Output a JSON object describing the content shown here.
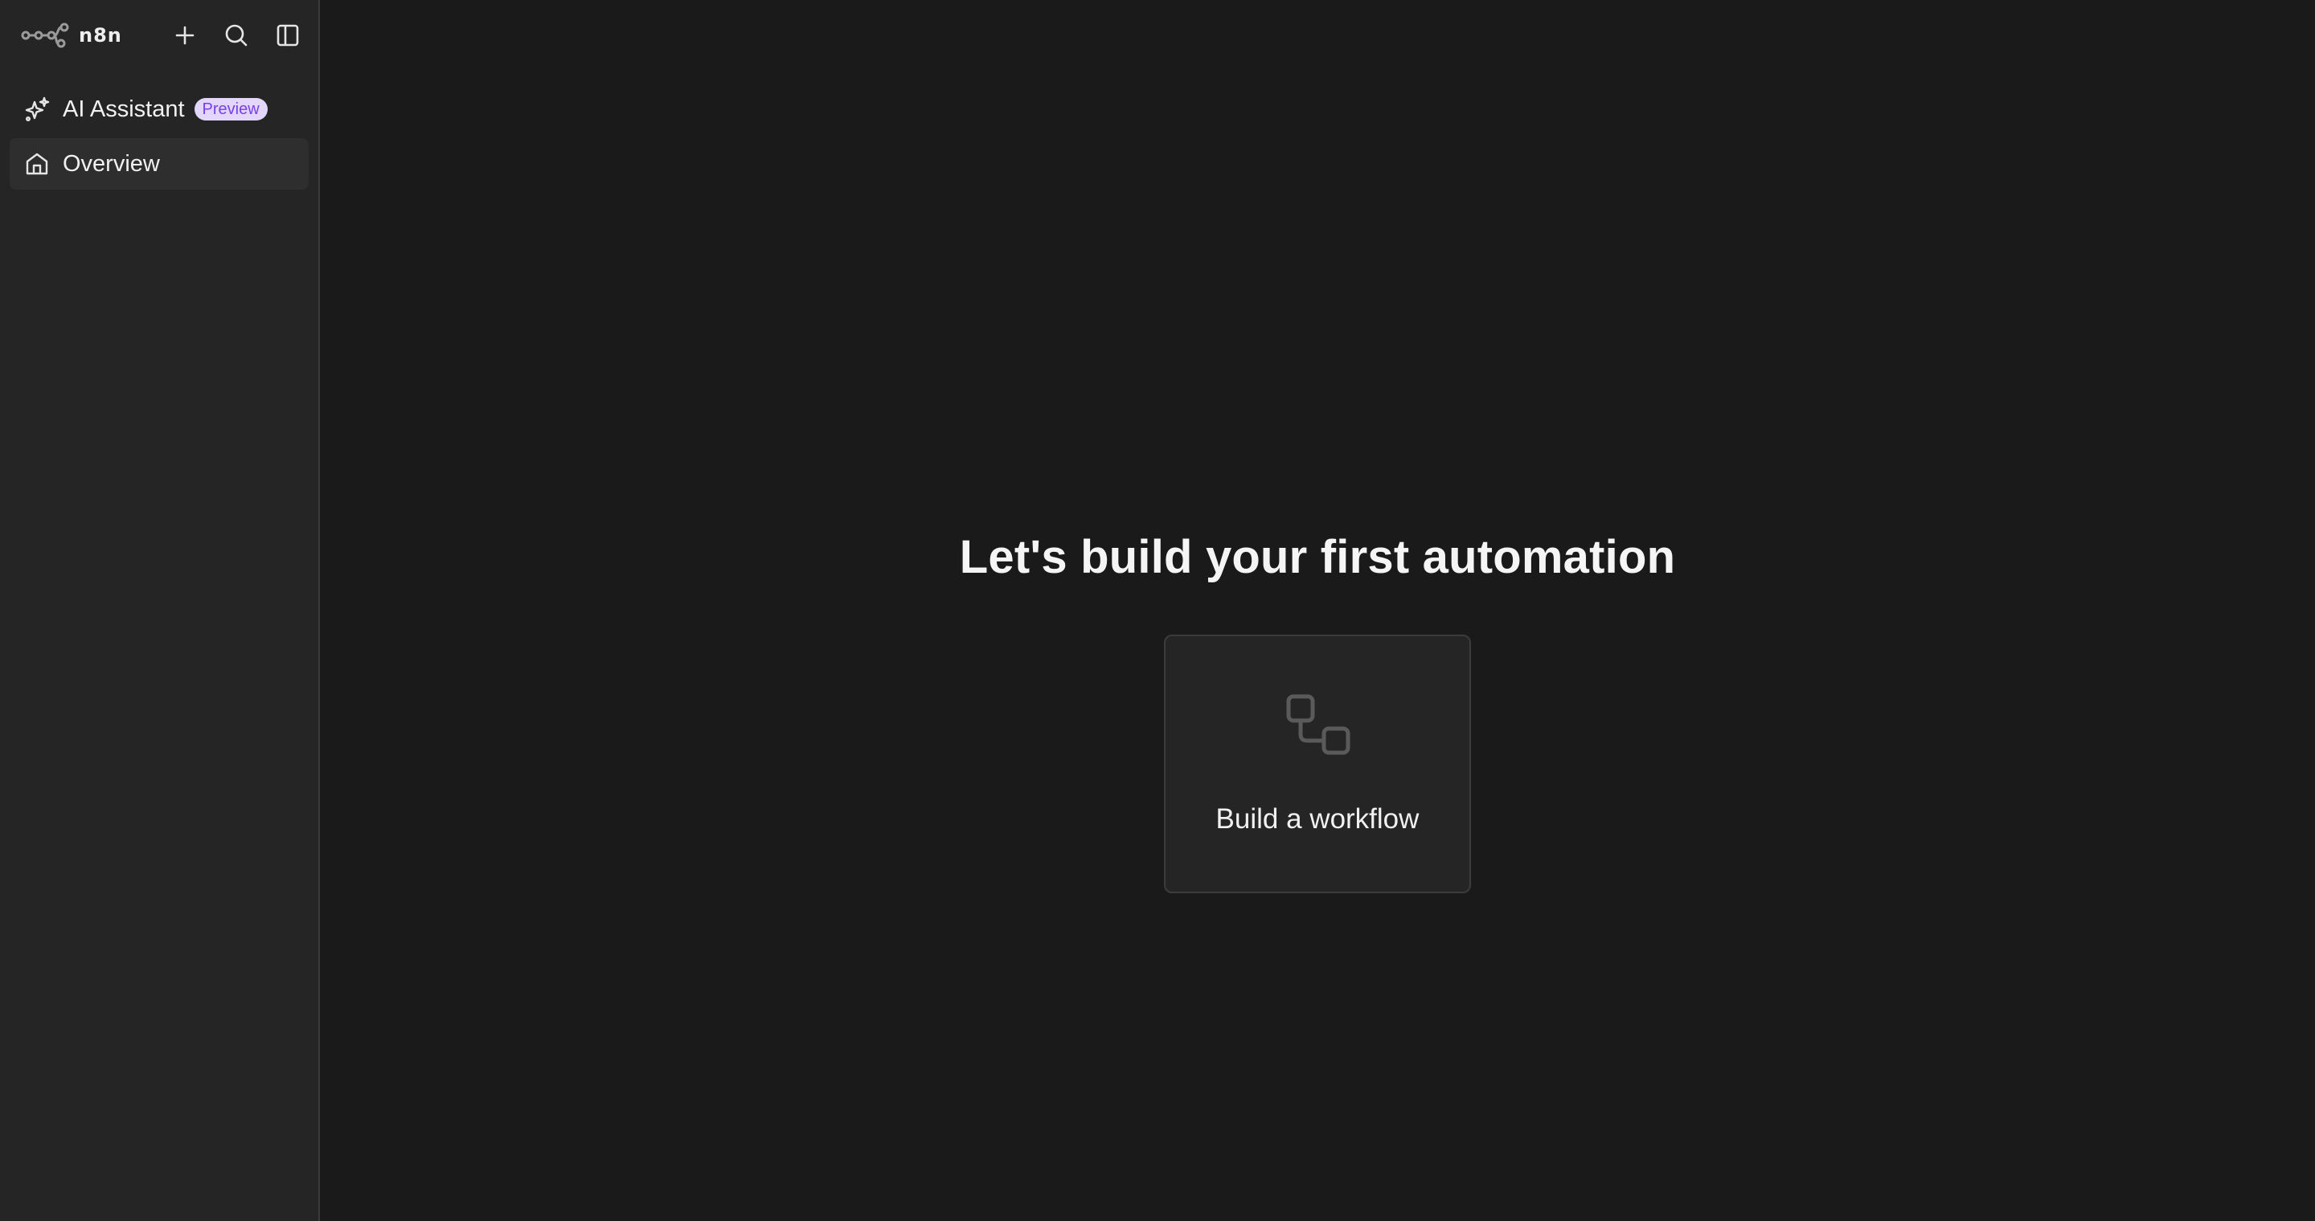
{
  "sidebar": {
    "brand": "n8n",
    "icons": {
      "logo": "n8n-logo-icon",
      "add": "plus-icon",
      "search": "search-icon",
      "toggle": "sidebar-toggle-icon"
    },
    "items": [
      {
        "label": "AI Assistant",
        "icon": "sparkles-icon",
        "badge": "Preview"
      },
      {
        "label": "Overview",
        "icon": "home-icon",
        "active": true
      }
    ]
  },
  "main": {
    "headline": "Let's build your first automation",
    "card": {
      "label": "Build a workflow",
      "icon": "workflow-icon"
    }
  },
  "colors": {
    "sidebar_bg": "#252525",
    "main_bg": "#1a1a1a",
    "badge_bg": "#e3d6fb",
    "badge_text": "#7b3fe4",
    "card_bg": "#252525"
  }
}
